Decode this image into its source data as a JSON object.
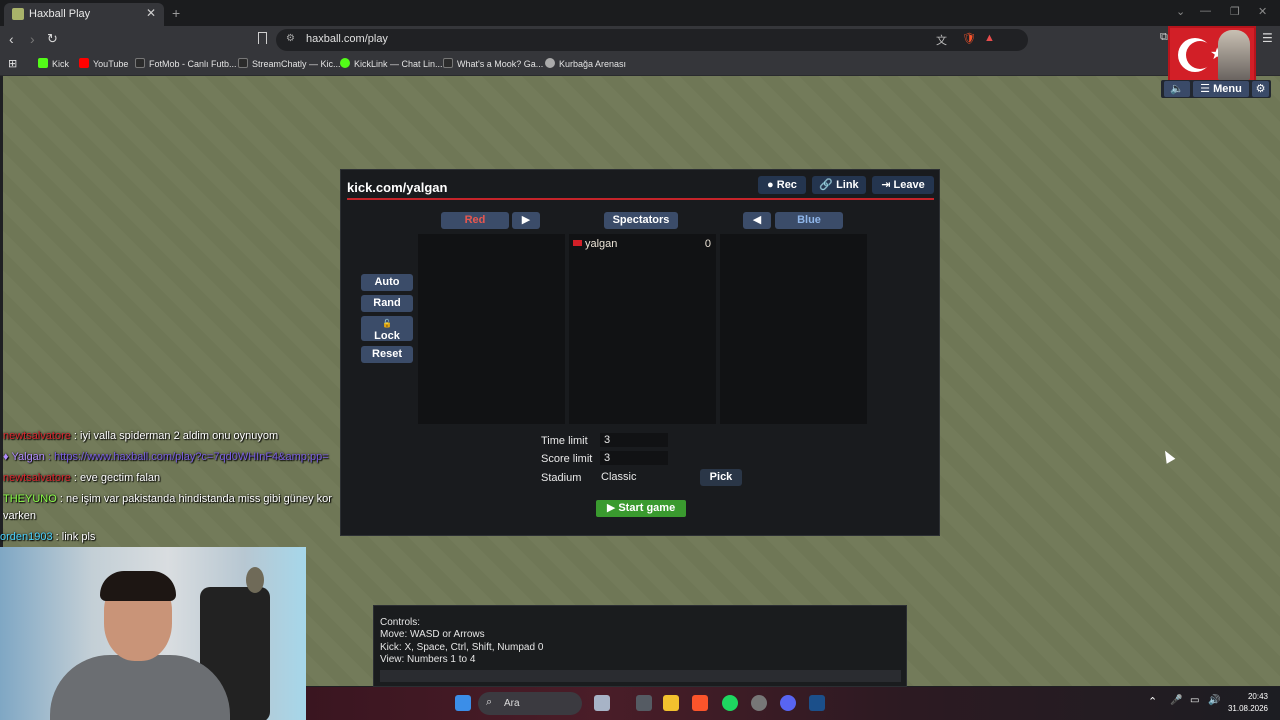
{
  "browser": {
    "tab_title": "Haxball Play",
    "url": "haxball.com/play",
    "bookmarks": [
      {
        "label": "Kick",
        "color": "#53fc18"
      },
      {
        "label": "YouTube",
        "color": "#ff0000"
      },
      {
        "label": "FotMob - Canlı Futb...",
        "color": "#2b2b2b"
      },
      {
        "label": "StreamChatly — Kic...",
        "color": "#2b2b2b"
      },
      {
        "label": "KickLink — Chat Lin...",
        "color": "#53fc18"
      },
      {
        "label": "What's a Mook? Ga...",
        "color": "#2b2b2b"
      },
      {
        "label": "Kurbağa Arenası",
        "color": "#aaaaaa"
      }
    ]
  },
  "topmenu": {
    "sound_icon": "speaker-icon",
    "menu_label": "☰ Menu",
    "settings_icon": "gear-icon"
  },
  "room": {
    "title": "kick.com/yalgan",
    "rec_label": "● Rec",
    "link_label": "🔗 Link",
    "leave_label": "⇥ Leave",
    "red_label": "Red",
    "spectators_label": "Spectators",
    "blue_label": "Blue",
    "move_right_label": "▶",
    "move_left_label": "◀",
    "auto_label": "Auto",
    "rand_label": "Rand",
    "lock_label": "Lock",
    "reset_label": "Reset",
    "spectators": [
      {
        "name": "yalgan",
        "score": "0"
      }
    ],
    "time_limit_label": "Time limit",
    "time_limit_value": "3",
    "score_limit_label": "Score limit",
    "score_limit_value": "3",
    "stadium_label": "Stadium",
    "stadium_value": "Classic",
    "pick_label": "Pick",
    "start_label": "▶ Start game",
    "accent_red": "#c5242a",
    "accent_green": "#3a9a2f"
  },
  "chat": [
    {
      "name": "newtsalvatore",
      "name_color": "#d7262e",
      "text": " : iyi valla spiderman 2 aldim onu oynuyom"
    },
    {
      "name": "Yalgan",
      "name_color": "#b18cff",
      "text": " : https://www.haxball.com/play?c=7qd0WHInF4&amp;pp="
    },
    {
      "name": "newtsalvatore",
      "name_color": "#d7262e",
      "text": " : eve gectim falan"
    },
    {
      "name": "THEYUNO",
      "name_color": "#8cff4a",
      "text": " : ne işim var pakistanda hindistanda miss gibi güney kor"
    },
    {
      "name": "",
      "name_color": "#ffffff",
      "text": "varken"
    },
    {
      "name": "orden1903",
      "name_color": "#4ad3ff",
      "text": " : link pls"
    }
  ],
  "controls": {
    "title": "Controls:",
    "move": "Move: WASD or Arrows",
    "kick": "Kick: X, Space, Ctrl, Shift, Numpad 0",
    "view": "View: Numbers 1 to 4"
  },
  "taskbar": {
    "search_label": "Ara",
    "time": "20:43",
    "date": "31.08.2026"
  }
}
